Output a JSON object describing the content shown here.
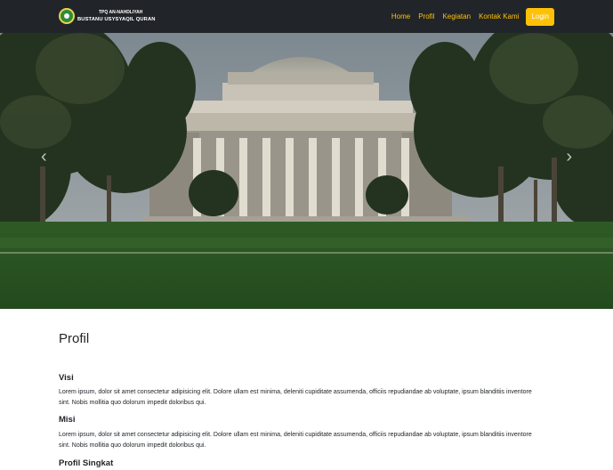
{
  "navbar": {
    "brand_sub": "TPQ AN-NAHDLIYAH",
    "brand_main": "BUSTANU USYSYAQIL QURAN",
    "links": [
      "Home",
      "Profil",
      "Kegiatan",
      "Kontak Kami"
    ],
    "login_label": "Login",
    "accent_color": "#ffc107",
    "background_color": "#212529"
  },
  "carousel": {
    "prev_icon": "chevron-left-icon",
    "next_icon": "chevron-right-icon",
    "prev_glyph": "‹",
    "next_glyph": "›"
  },
  "main": {
    "title": "Profil",
    "visi_heading": "Visi",
    "visi_text": "Lorem ipsum, dolor sit amet consectetur adipisicing elit. Dolore ullam est minima, deleniti cupiditate assumenda, officiis repudiandae ab voluptate, ipsum blanditiis inventore sint. Nobis mollitia quo dolorum impedit doloribus qui.",
    "misi_heading": "Misi",
    "misi_text": "Lorem ipsum, dolor sit amet consectetur adipisicing elit. Dolore ullam est minima, deleniti cupiditate assumenda, officiis repudiandae ab voluptate, ipsum blanditiis inventore sint. Nobis mollitia quo dolorum impedit doloribus qui.",
    "profil_heading": "Profil Singkat"
  }
}
